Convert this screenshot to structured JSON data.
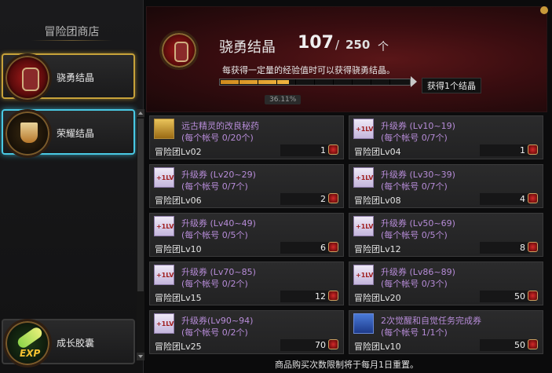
{
  "sidebar": {
    "title": "冒险团商店",
    "items": [
      {
        "label": "骁勇结晶",
        "icon": "fist-crystal-icon"
      },
      {
        "label": "荣耀结晶",
        "icon": "golden-cup-icon"
      },
      {
        "label": "成长胶囊",
        "icon": "exp-capsule-icon"
      }
    ]
  },
  "header": {
    "title": "骁勇结晶",
    "count": "107",
    "slash": "/",
    "max": "250",
    "unit": "个",
    "description": "每获得一定量的经验值时可以获得骁勇结晶。",
    "progress_percent": 36.11,
    "progress_label": "36.11%",
    "reward_label": "获得1个结晶"
  },
  "items": [
    {
      "name": "远古精灵的改良秘药",
      "limit": "(每个帐号 0/20个)",
      "req": "冒险团Lv02",
      "price": "1",
      "icon": "potion"
    },
    {
      "name": "升级券 (Lv10~19)",
      "limit": "(每个帐号 0/7个)",
      "req": "冒险团Lv04",
      "price": "1",
      "icon": "ticket"
    },
    {
      "name": "升级券 (Lv20~29)",
      "limit": "(每个帐号 0/7个)",
      "req": "冒险团Lv06",
      "price": "2",
      "icon": "ticket"
    },
    {
      "name": "升级券 (Lv30~39)",
      "limit": "(每个帐号 0/7个)",
      "req": "冒险团Lv08",
      "price": "4",
      "icon": "ticket"
    },
    {
      "name": "升级券 (Lv40~49)",
      "limit": "(每个帐号 0/5个)",
      "req": "冒险团Lv10",
      "price": "6",
      "icon": "ticket"
    },
    {
      "name": "升级券 (Lv50~69)",
      "limit": "(每个帐号 0/5个)",
      "req": "冒险团Lv12",
      "price": "8",
      "icon": "ticket"
    },
    {
      "name": "升级券 (Lv70~85)",
      "limit": "(每个帐号 0/2个)",
      "req": "冒险团Lv15",
      "price": "12",
      "icon": "ticket"
    },
    {
      "name": "升级券 (Lv86~89)",
      "limit": "(每个帐号 0/3个)",
      "req": "冒险团Lv20",
      "price": "50",
      "icon": "ticket"
    },
    {
      "name": "升级券(Lv90~94)",
      "limit": "(每个帐号 0/2个)",
      "req": "冒险团Lv25",
      "price": "70",
      "icon": "ticket"
    },
    {
      "name": "2次觉醒和自觉任务完成券",
      "limit": "(每个帐号 1/1个)",
      "req": "冒险团Lv10",
      "price": "50",
      "icon": "awake"
    }
  ],
  "footer": {
    "note": "商品购买次数限制将于每月1日重置。"
  },
  "colors": {
    "accent_gold": "#c7a23a",
    "accent_cyan": "#49c9e4",
    "item_name_purple": "#b78cd8",
    "progress_orange": "#f0b540"
  }
}
